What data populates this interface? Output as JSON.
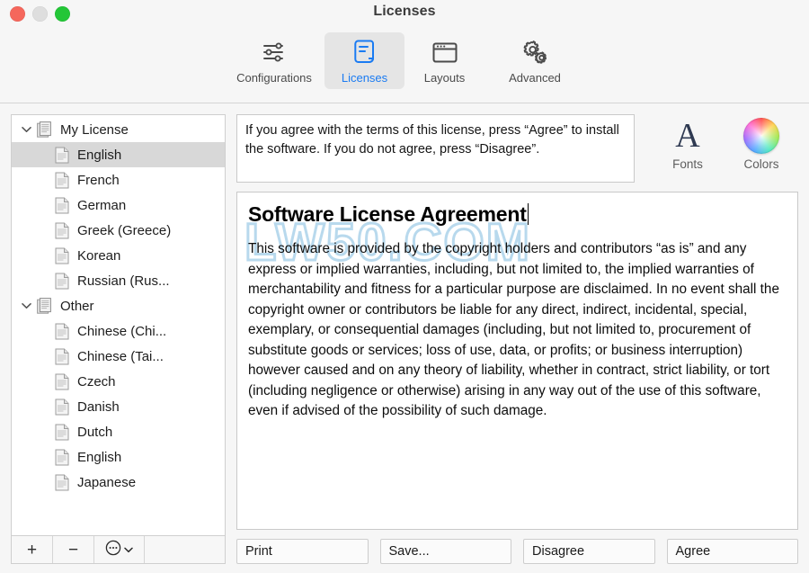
{
  "window": {
    "title": "Licenses",
    "traffic_lights": [
      "close",
      "minimize",
      "zoom"
    ]
  },
  "toolbar": {
    "items": [
      {
        "label": "Configurations",
        "icon": "sliders-icon",
        "active": false
      },
      {
        "label": "Licenses",
        "icon": "license-scroll-icon",
        "active": true
      },
      {
        "label": "Layouts",
        "icon": "window-layout-icon",
        "active": false
      },
      {
        "label": "Advanced",
        "icon": "gears-icon",
        "active": false
      }
    ],
    "accent_color": "#1a7bf2",
    "active_background": "#e5e5e5"
  },
  "sidebar": {
    "groups": [
      {
        "label": "My License",
        "icon": "documents-stack-icon",
        "expanded": true,
        "children": [
          {
            "label": "English",
            "icon": "document-icon",
            "selected": true
          },
          {
            "label": "French",
            "icon": "document-icon",
            "selected": false
          },
          {
            "label": "German",
            "icon": "document-icon",
            "selected": false
          },
          {
            "label": "Greek (Greece)",
            "icon": "document-icon",
            "selected": false
          },
          {
            "label": "Korean",
            "icon": "document-icon",
            "selected": false
          },
          {
            "label": "Russian (Rus...",
            "icon": "document-icon",
            "selected": false
          }
        ]
      },
      {
        "label": "Other",
        "icon": "documents-stack-icon",
        "expanded": true,
        "children": [
          {
            "label": "Chinese (Chi...",
            "icon": "document-icon",
            "selected": false
          },
          {
            "label": "Chinese (Tai...",
            "icon": "document-icon",
            "selected": false
          },
          {
            "label": "Czech",
            "icon": "document-icon",
            "selected": false
          },
          {
            "label": "Danish",
            "icon": "document-icon",
            "selected": false
          },
          {
            "label": "Dutch",
            "icon": "document-icon",
            "selected": false
          },
          {
            "label": "English",
            "icon": "document-icon",
            "selected": false
          },
          {
            "label": "Japanese",
            "icon": "document-icon",
            "selected": false
          }
        ]
      }
    ],
    "footer": {
      "add_label": "+",
      "remove_label": "−",
      "action_icon": "ellipsis-circle-icon",
      "action_chevron": "chevron-down-icon"
    },
    "selection_color": "#d8d8d8"
  },
  "main": {
    "description": "If you agree with the terms of this license, press “Agree” to install the software. If you do not agree, press “Disagree”.",
    "format_tools": [
      {
        "label": "Fonts",
        "icon": "font-a-icon"
      },
      {
        "label": "Colors",
        "icon": "color-wheel-icon"
      }
    ],
    "document": {
      "title": "Software License Agreement",
      "body": "This software is provided by the copyright holders and contributors “as is” and any express or implied warranties, including, but not limited to, the implied warranties of merchantability and fitness for a particular purpose are disclaimed. In no event shall the copyright owner or contributors be liable for any direct, indirect, incidental, special, exemplary, or consequential damages (including, but not limited to, procurement of substitute goods or services; loss of use, data, or profits; or business interruption) however caused and on any theory of liability, whether in contract, strict liability, or tort (including negligence or otherwise) arising in any way out of the use of this software, even if advised of the possibility of such damage.",
      "watermark": "LW50.COM",
      "watermark_color": "#7db9de",
      "has_text_caret": true
    },
    "buttons": [
      {
        "label": "Print"
      },
      {
        "label": "Save..."
      },
      {
        "label": "Disagree"
      },
      {
        "label": "Agree"
      }
    ]
  }
}
